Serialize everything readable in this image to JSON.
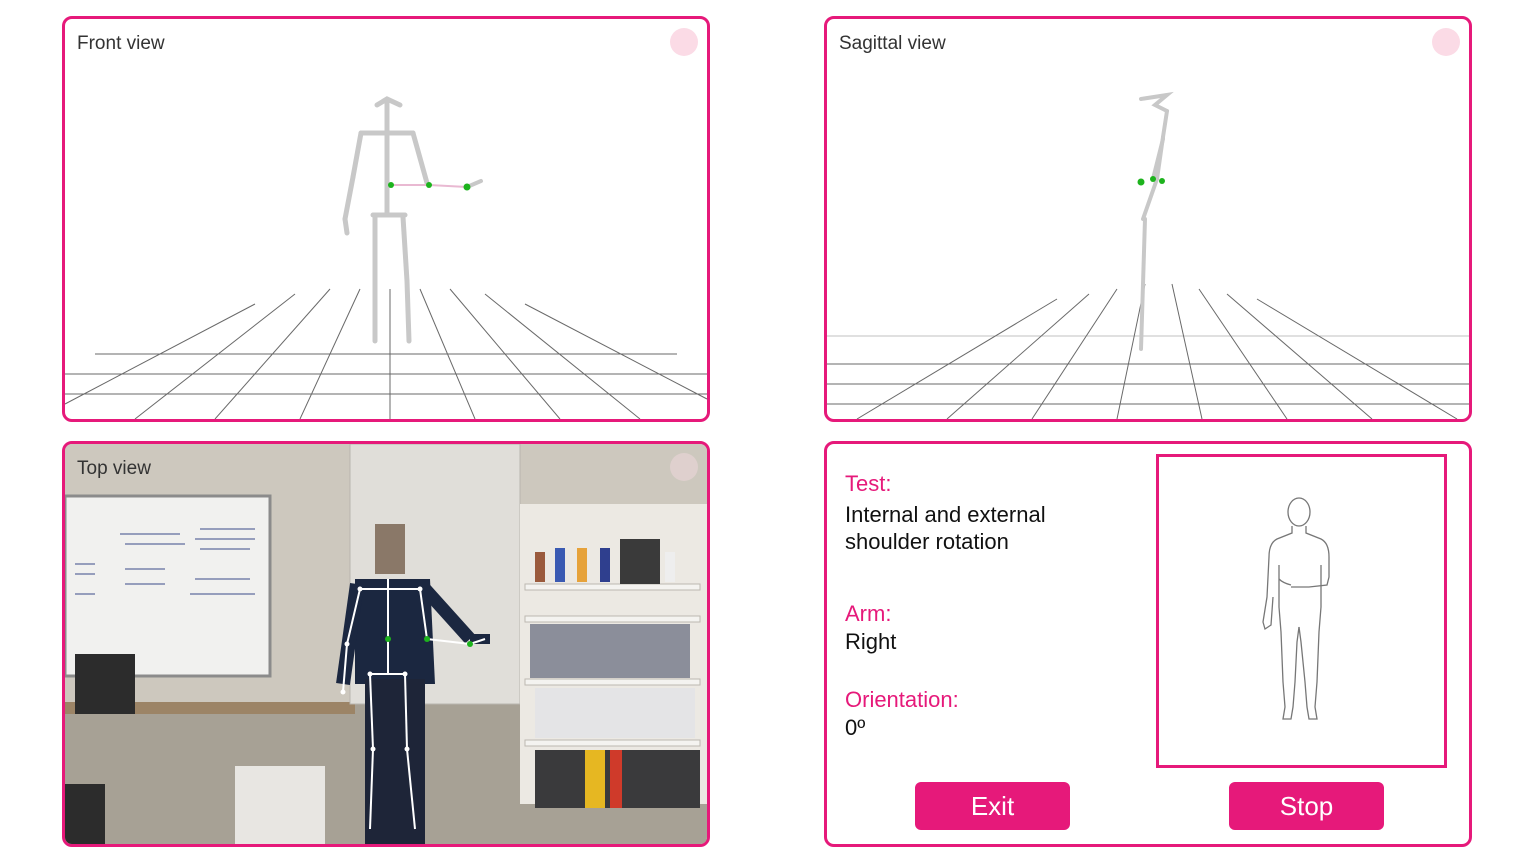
{
  "views": {
    "front": {
      "label": "Front view"
    },
    "sagittal": {
      "label": "Sagittal view"
    },
    "top": {
      "label": "Top view"
    }
  },
  "info": {
    "test_label": "Test:",
    "test_value": "Internal and external shoulder rotation",
    "arm_label": "Arm:",
    "arm_value": "Right",
    "orientation_label": "Orientation:",
    "orientation_value": "0º"
  },
  "buttons": {
    "exit": "Exit",
    "stop": "Stop"
  },
  "colors": {
    "accent": "#e6197a",
    "joint": "#1db31d",
    "bone": "#c8c8c8"
  }
}
